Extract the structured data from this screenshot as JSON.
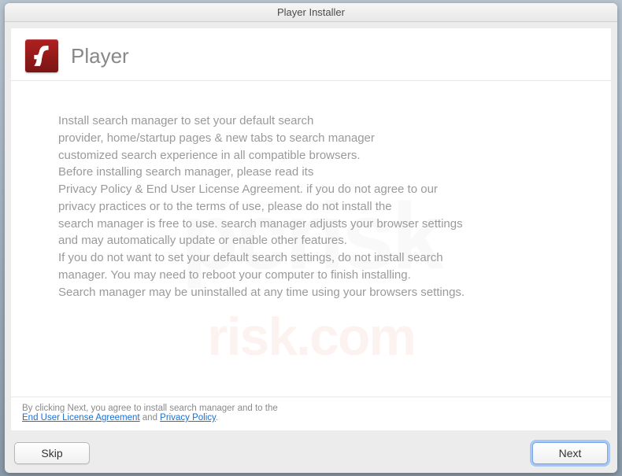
{
  "titlebar": {
    "title": "Player Installer"
  },
  "header": {
    "title": "Player"
  },
  "body": {
    "text": "Install search manager to set your default search\nprovider, home/startup pages & new tabs to search manager\ncustomized search experience in all compatible browsers.\nBefore installing search manager, please read its\nPrivacy Policy & End User License Agreement. if you do not agree to our\nprivacy practices or to the terms of use, please do not install the\nsearch manager is free to use. search manager adjusts your browser settings\nand may automatically update or enable other features.\nIf you do not want to set your default search settings, do not install search\nmanager. You may need to reboot your computer to finish installing.\nSearch manager may be uninstalled at any time using your browsers settings."
  },
  "footer": {
    "prefix": "By clicking Next, you agree to install search manager and to the",
    "eula_label": "End User License Agreement",
    "and": " and ",
    "privacy_label": "Privacy Policy",
    "suffix": "."
  },
  "buttons": {
    "skip": "Skip",
    "next": "Next"
  },
  "watermark": {
    "main": "pcrisk",
    "sub": "risk.com"
  }
}
